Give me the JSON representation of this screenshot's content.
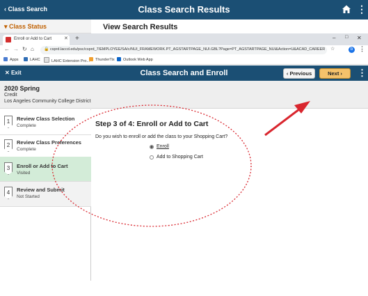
{
  "outer": {
    "back_label": "Class Search",
    "title": "Class Search Results",
    "class_status": "Class Status",
    "view_results": "View Search Results"
  },
  "browser": {
    "tab_title": "Enroll or Add to Cart",
    "new_tab": "+",
    "url": "csprd.laccd.edu/psc/csprd_7/EMPLOYEE/SA/c/NUI_FRAMEWORK.PT_AGSTARTPAGE_NUI.GBL?Page=PT_AGSTARTPAGE_NUI&Action=U&ACAD_CAREER=&...",
    "profile_initial": "b",
    "bookmarks": [
      "Apps",
      "LAHC",
      "LAHC Extension Pro...",
      "ThunderTix",
      "Outlook Web App"
    ]
  },
  "app": {
    "exit_label": "Exit",
    "title": "Class Search and Enroll",
    "prev_label": "Previous",
    "next_label": "Next"
  },
  "term": {
    "name": "2020 Spring",
    "career": "Credit",
    "institution": "Los Angeles Community College District"
  },
  "steps": [
    {
      "num": "1",
      "title": "Review Class Selection",
      "status": "Complete"
    },
    {
      "num": "2",
      "title": "Review Class Preferences",
      "status": "Complete"
    },
    {
      "num": "3",
      "title": "Enroll or Add to Cart",
      "status": "Visited"
    },
    {
      "num": "4",
      "title": "Review and Submit",
      "status": "Not Started"
    }
  ],
  "content": {
    "heading": "Step 3 of 4: Enroll or Add to Cart",
    "question": "Do you wish to enroll or add the class to your Shopping Cart?",
    "options": [
      {
        "label": "Enroll",
        "selected": true
      },
      {
        "label": "Add to Shopping Cart",
        "selected": false
      }
    ]
  },
  "colors": {
    "header": "#1b4f74",
    "next_button": "#f5c26b",
    "active_step": "#d3ecd8",
    "annotation": "#d9262e"
  }
}
